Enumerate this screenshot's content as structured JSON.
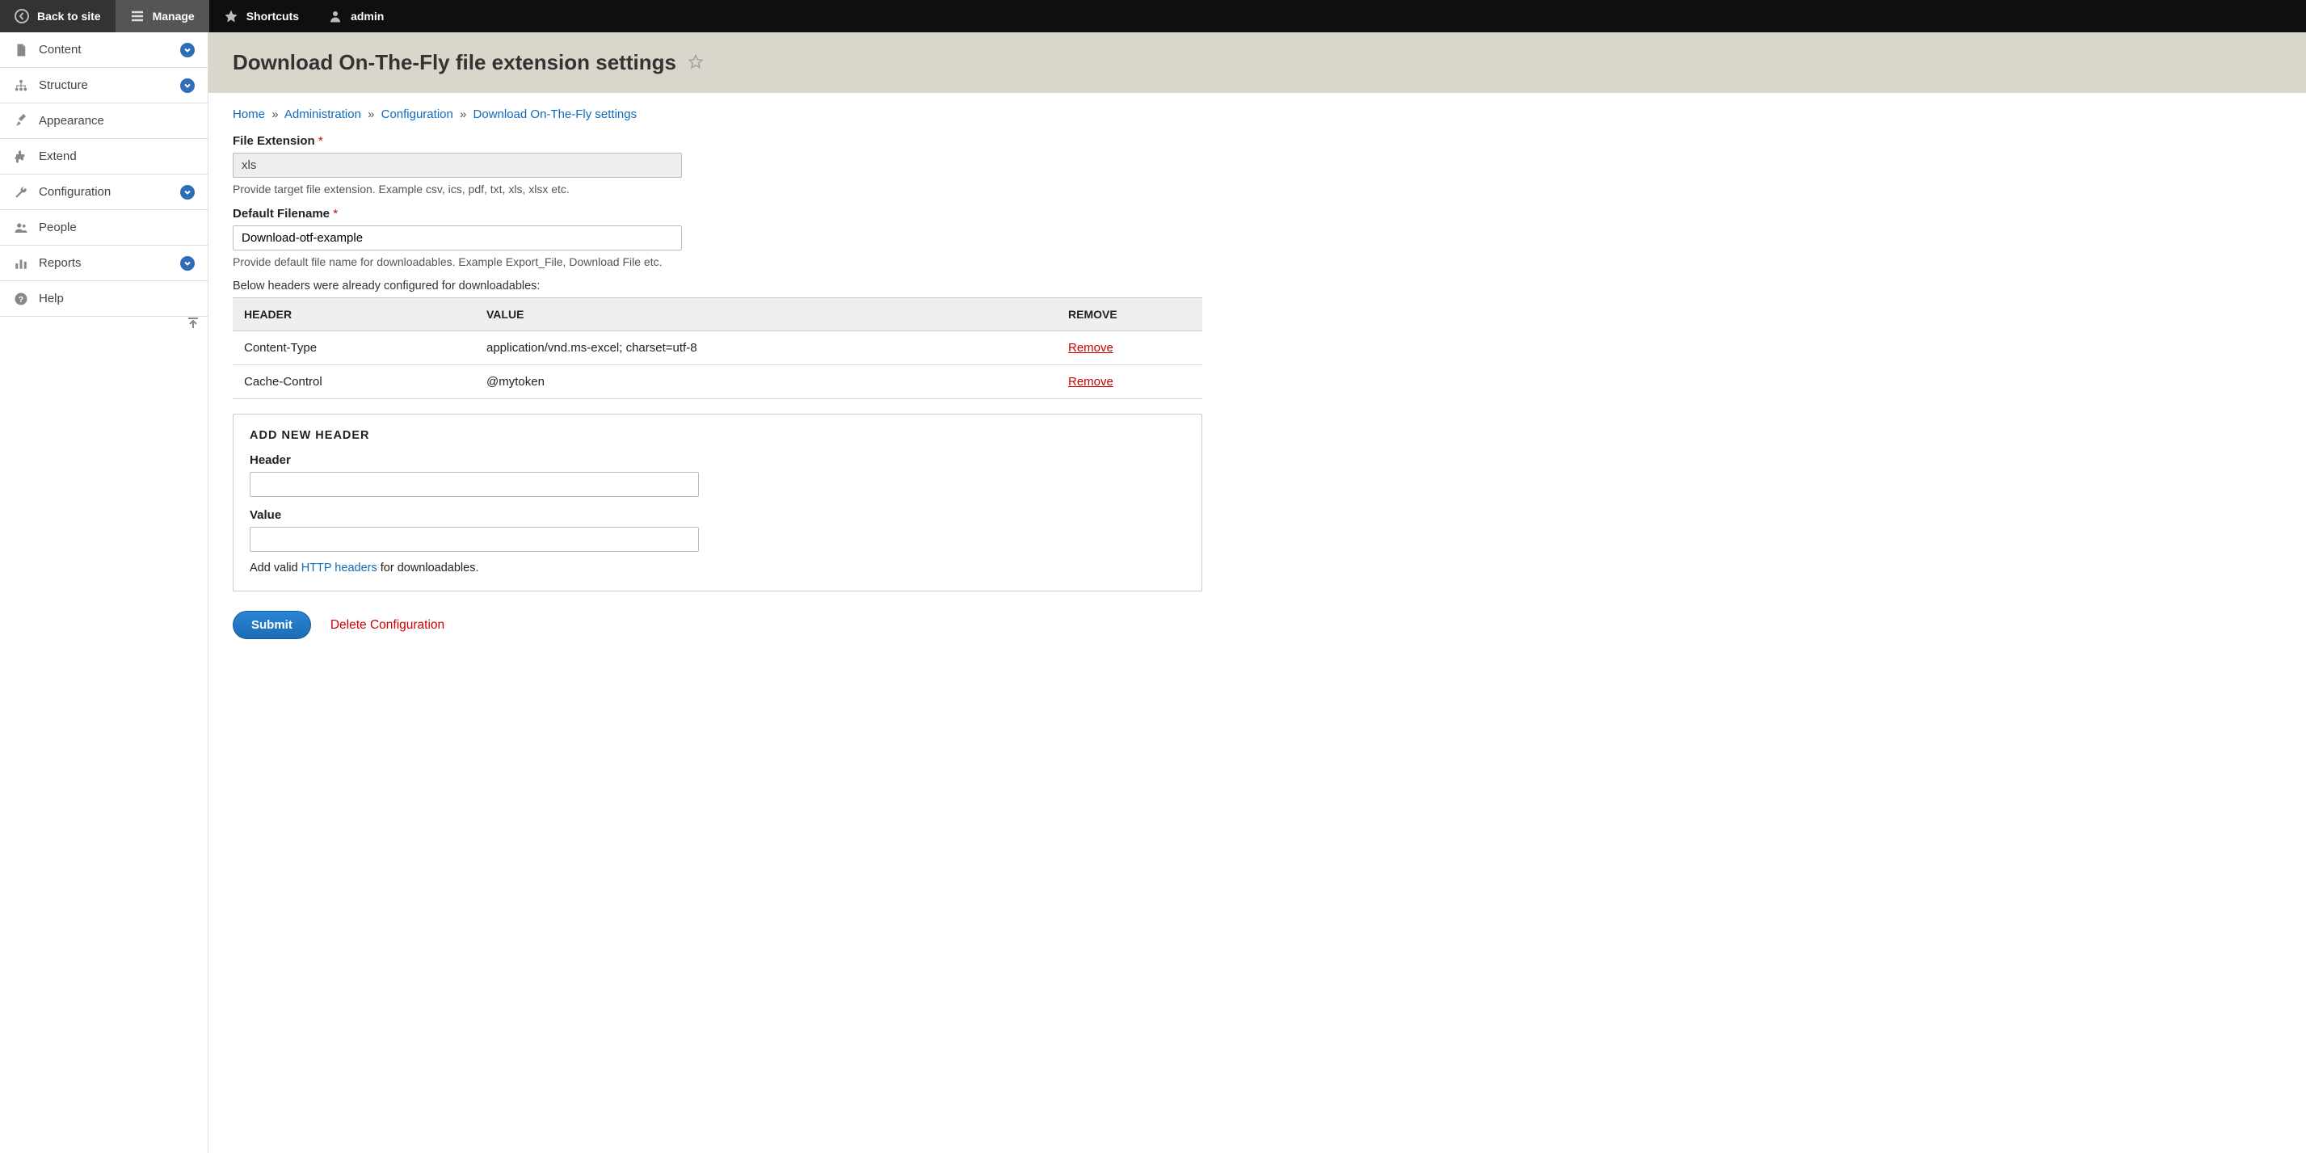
{
  "toolbar": {
    "back": "Back to site",
    "manage": "Manage",
    "shortcuts": "Shortcuts",
    "user": "admin"
  },
  "sidebar": {
    "items": [
      {
        "label": "Content",
        "expandable": true
      },
      {
        "label": "Structure",
        "expandable": true
      },
      {
        "label": "Appearance",
        "expandable": false
      },
      {
        "label": "Extend",
        "expandable": false
      },
      {
        "label": "Configuration",
        "expandable": true
      },
      {
        "label": "People",
        "expandable": false
      },
      {
        "label": "Reports",
        "expandable": true
      },
      {
        "label": "Help",
        "expandable": false
      }
    ]
  },
  "page": {
    "title": "Download On-The-Fly file extension settings"
  },
  "breadcrumb": {
    "home": "Home",
    "administration": "Administration",
    "configuration": "Configuration",
    "settings": "Download On-The-Fly settings"
  },
  "form": {
    "file_ext_label": "File Extension",
    "file_ext_value": "xls",
    "file_ext_desc": "Provide target file extension. Example csv, ics, pdf, txt, xls, xlsx etc.",
    "default_filename_label": "Default Filename",
    "default_filename_value": "Download-otf-example",
    "default_filename_desc": "Provide default file name for downloadables. Example Export_File, Download File etc.",
    "headers_note": "Below headers were already configured for downloadables:",
    "table": {
      "col_header": "HEADER",
      "col_value": "VALUE",
      "col_remove": "REMOVE",
      "rows": [
        {
          "header": "Content-Type",
          "value": "application/vnd.ms-excel; charset=utf-8",
          "remove": "Remove"
        },
        {
          "header": "Cache-Control",
          "value": "@mytoken",
          "remove": "Remove"
        }
      ]
    },
    "add_header": {
      "legend": "ADD NEW HEADER",
      "header_label": "Header",
      "value_label": "Value",
      "help_pre": "Add valid ",
      "help_link": "HTTP headers",
      "help_post": " for downloadables."
    },
    "submit": "Submit",
    "delete_config": "Delete Configuration"
  }
}
